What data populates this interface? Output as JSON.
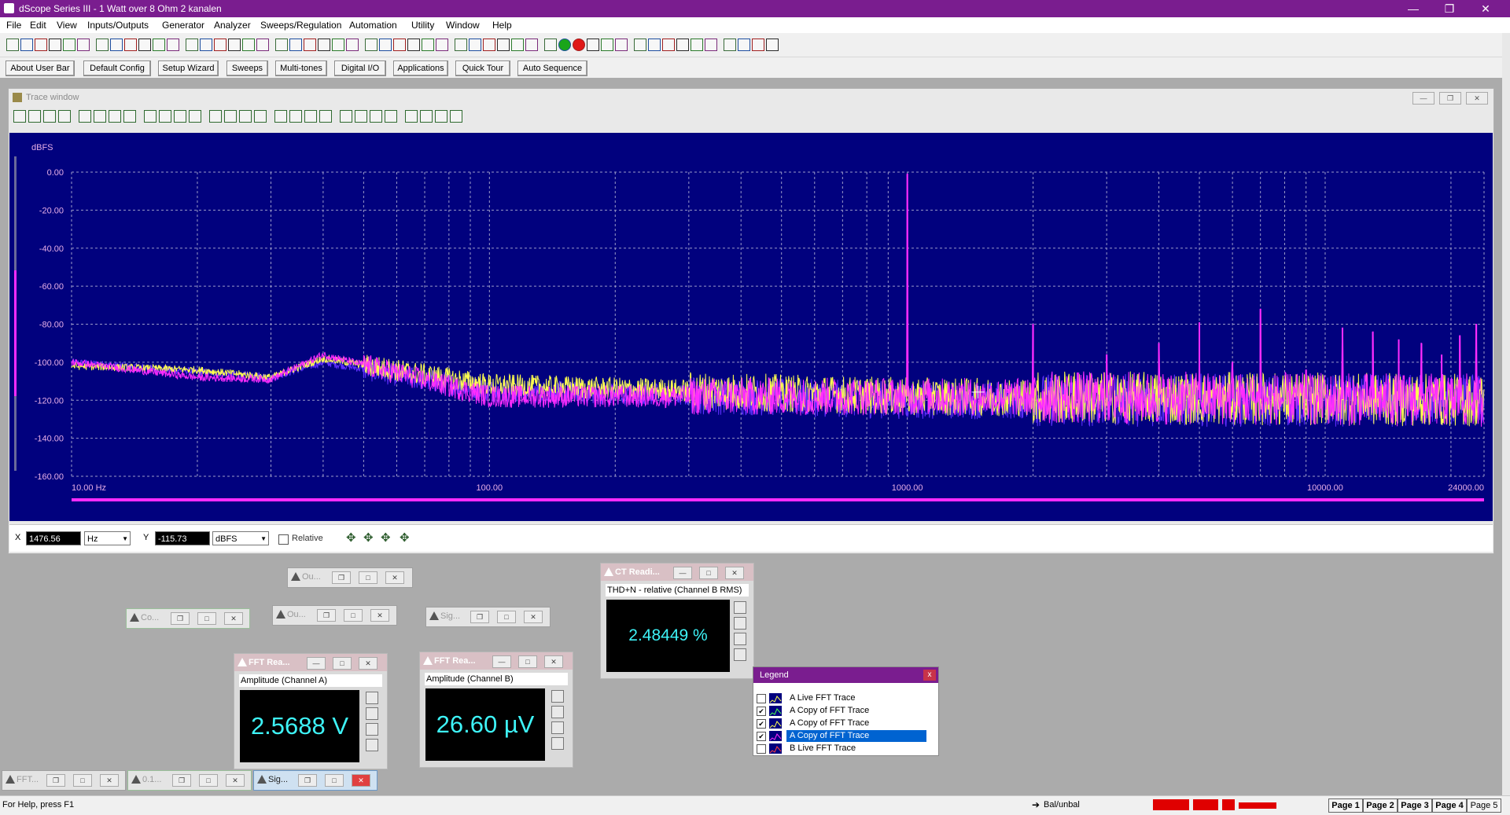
{
  "window": {
    "title": "dScope Series III - 1 Watt over 8 Ohm 2 kanalen",
    "minimize": "—",
    "maximize": "❐",
    "close": "✕"
  },
  "menu": [
    "File",
    "Edit",
    "View",
    "Inputs/Outputs",
    "Generator",
    "Analyzer",
    "Sweeps/Regulation",
    "Automation",
    "Utility",
    "Window",
    "Help"
  ],
  "user_bar": [
    "About User Bar",
    "Default Config",
    "Setup Wizard",
    "Sweeps",
    "Multi-tones",
    "Digital I/O",
    "Applications",
    "Quick Tour",
    "Auto Sequence"
  ],
  "trace_window": {
    "title": "Trace window",
    "cursor_x_label": "X",
    "cursor_x_value": "1476.56",
    "cursor_x_unit": "Hz",
    "cursor_y_label": "Y",
    "cursor_y_value": "-115.73",
    "cursor_y_unit": "dBFS",
    "relative_label": "Relative"
  },
  "chart_data": {
    "type": "line",
    "ylabel": "dBFS",
    "xscale": "log",
    "xlim": [
      10,
      24000
    ],
    "ylim": [
      -160,
      0
    ],
    "xtick_labels": [
      "10.00 Hz",
      "100.00",
      "1000.00",
      "10000.00",
      "24000.00"
    ],
    "ytick_labels": [
      "0.00",
      "-20.00",
      "-40.00",
      "-60.00",
      "-80.00",
      "-100.00",
      "-120.00",
      "-140.00",
      "-160.00"
    ],
    "grid": true,
    "background": "#01017e",
    "series": [
      {
        "color": "#ffff4f",
        "noise_floor": [
          [
            10,
            -102
          ],
          [
            20,
            -104
          ],
          [
            30,
            -108
          ],
          [
            40,
            -98
          ],
          [
            100,
            -112
          ],
          [
            1000,
            -118
          ],
          [
            24000,
            -120
          ]
        ]
      },
      {
        "color": "#5f2fff",
        "noise_floor": [
          [
            10,
            -100
          ],
          [
            20,
            -105
          ],
          [
            30,
            -108
          ],
          [
            40,
            -100
          ],
          [
            100,
            -115
          ],
          [
            1000,
            -120
          ],
          [
            24000,
            -120
          ]
        ]
      },
      {
        "color": "#ff2cff",
        "noise_floor": [
          [
            10,
            -100
          ],
          [
            20,
            -108
          ],
          [
            30,
            -109
          ],
          [
            40,
            -96
          ],
          [
            100,
            -118
          ],
          [
            1000,
            -118
          ],
          [
            24000,
            -120
          ]
        ],
        "peaks": [
          [
            1000,
            -1
          ],
          [
            2000,
            -80
          ],
          [
            3000,
            -96
          ],
          [
            4000,
            -90
          ],
          [
            5000,
            -79
          ],
          [
            6000,
            -100
          ],
          [
            7000,
            -72
          ],
          [
            9000,
            -104
          ],
          [
            11000,
            -82
          ],
          [
            13000,
            -84
          ],
          [
            15000,
            -88
          ],
          [
            17000,
            -90
          ],
          [
            19000,
            -96
          ],
          [
            21000,
            -86
          ],
          [
            23000,
            -80
          ]
        ]
      }
    ]
  },
  "mini_windows": [
    {
      "caption": "Ou..."
    },
    {
      "caption": "Co..."
    },
    {
      "caption": "Ou..."
    },
    {
      "caption": "Sig..."
    },
    {
      "caption": "FFT..."
    },
    {
      "caption": "0.1..."
    },
    {
      "caption": "Sig..."
    }
  ],
  "meters": {
    "ct": {
      "title": "CT Readi...",
      "label": "THD+N - relative (Channel B RMS)",
      "value": "2.48449 %"
    },
    "fft_a": {
      "title": "FFT Rea...",
      "label": "Amplitude (Channel A)",
      "value": "2.5688 V"
    },
    "fft_b": {
      "title": "FFT Rea...",
      "label": "Amplitude (Channel B)",
      "value": "26.60 µV"
    }
  },
  "legend": {
    "title": "Legend",
    "items": [
      {
        "label": "A  Live FFT Trace",
        "checked": false,
        "selected": false
      },
      {
        "label": "A  Copy of FFT Trace",
        "checked": true,
        "selected": false
      },
      {
        "label": "A  Copy of FFT Trace",
        "checked": true,
        "selected": false
      },
      {
        "label": "A  Copy of FFT Trace",
        "checked": true,
        "selected": true
      },
      {
        "label": "B  Live FFT Trace",
        "checked": false,
        "selected": false
      }
    ]
  },
  "status": {
    "help": "For Help, press F1",
    "balunbal": "Bal/unbal",
    "pages": [
      "Page 1",
      "Page 2",
      "Page 3",
      "Page 4",
      "Page 5"
    ]
  }
}
